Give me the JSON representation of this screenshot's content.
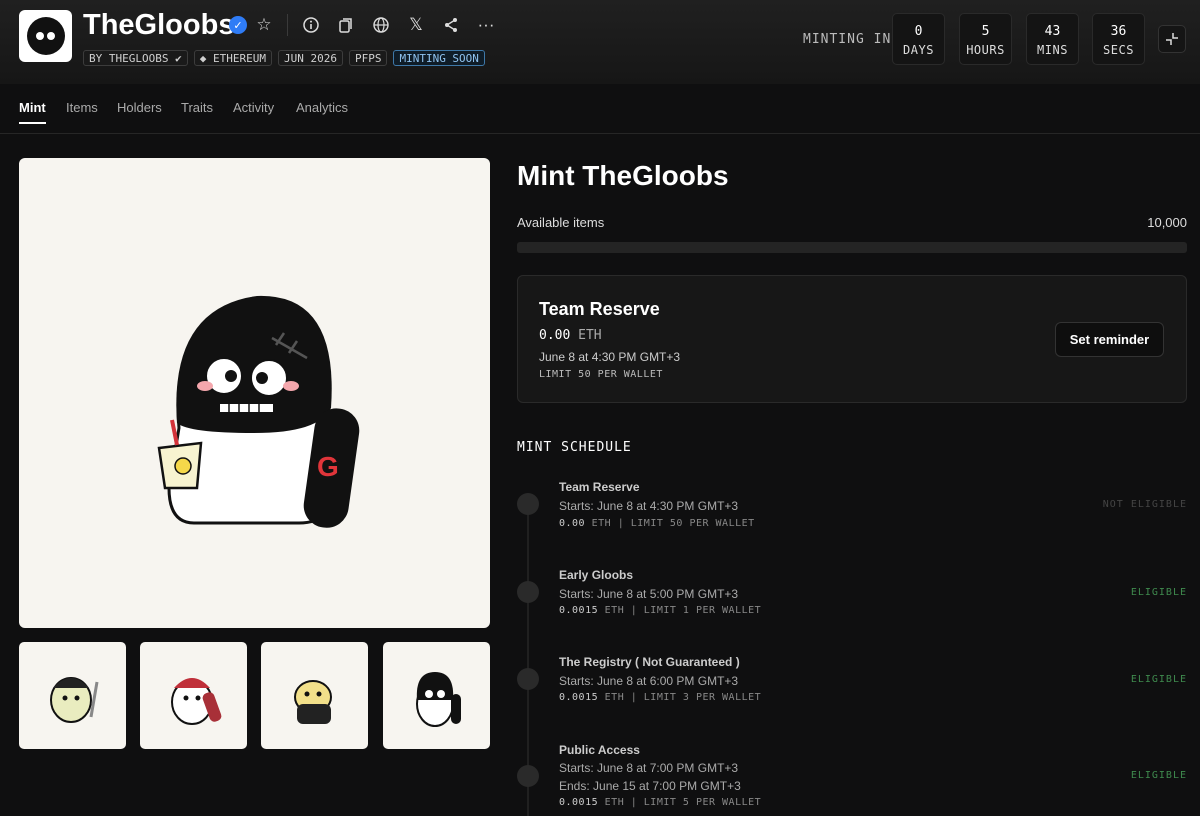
{
  "header": {
    "title": "TheGloobs",
    "tags": [
      "BY THEGLOOBS",
      "ETHEREUM",
      "JUN 2026",
      "PFPS",
      "MINTING SOON"
    ],
    "minting_in_label": "MINTING IN",
    "countdown": [
      {
        "value": "0",
        "label": "DAYS"
      },
      {
        "value": "5",
        "label": "HOURS"
      },
      {
        "value": "43",
        "label": "MINS"
      },
      {
        "value": "36",
        "label": "SECS"
      }
    ],
    "icons": [
      "star-icon",
      "info-icon",
      "copy-icon",
      "globe-icon",
      "x-icon",
      "share-icon",
      "more-icon"
    ]
  },
  "tabs": [
    "Mint",
    "Items",
    "Holders",
    "Traits",
    "Activity",
    "Analytics"
  ],
  "active_tab": "Mint",
  "mint": {
    "title": "Mint TheGloobs",
    "available_label": "Available items",
    "available_value": "10,000",
    "progress_fraction": 0
  },
  "current_stage": {
    "name": "Team Reserve",
    "price": "0.00",
    "unit": "ETH",
    "date": "June 8 at 4:30 PM GMT+3",
    "limit": "LIMIT 50 PER WALLET",
    "button": "Set reminder"
  },
  "schedule_label": "MINT SCHEDULE",
  "schedule": [
    {
      "name": "Team Reserve",
      "starts": "Starts: June 8 at 4:30 PM GMT+3",
      "ends": "",
      "price": "0.00",
      "unit": "ETH",
      "limit": "| LIMIT 50 PER WALLET",
      "status": "NOT ELIGIBLE",
      "status_color": "#444444"
    },
    {
      "name": "Early Gloobs",
      "starts": "Starts: June 8 at 5:00 PM GMT+3",
      "ends": "",
      "price": "0.0015",
      "unit": "ETH",
      "limit": "| LIMIT 1 PER WALLET",
      "status": "ELIGIBLE",
      "status_color": "#3f8a4e"
    },
    {
      "name": "The Registry ( Not Guaranteed )",
      "starts": "Starts: June 8 at 6:00 PM GMT+3",
      "ends": "",
      "price": "0.0015",
      "unit": "ETH",
      "limit": "| LIMIT 3 PER WALLET",
      "status": "ELIGIBLE",
      "status_color": "#3f8a4e"
    },
    {
      "name": "Public Access",
      "starts": "Starts: June 8 at 7:00 PM GMT+3",
      "ends": "Ends: June 15 at 7:00 PM GMT+3",
      "price": "0.0015",
      "unit": "ETH",
      "limit": "| LIMIT 5 PER WALLET",
      "status": "ELIGIBLE",
      "status_color": "#3f8a4e"
    }
  ],
  "colors": {
    "accent_verified": "#2f7cf6",
    "minting_soon": "#8fc2ef",
    "eligible": "#3f8a4e"
  }
}
